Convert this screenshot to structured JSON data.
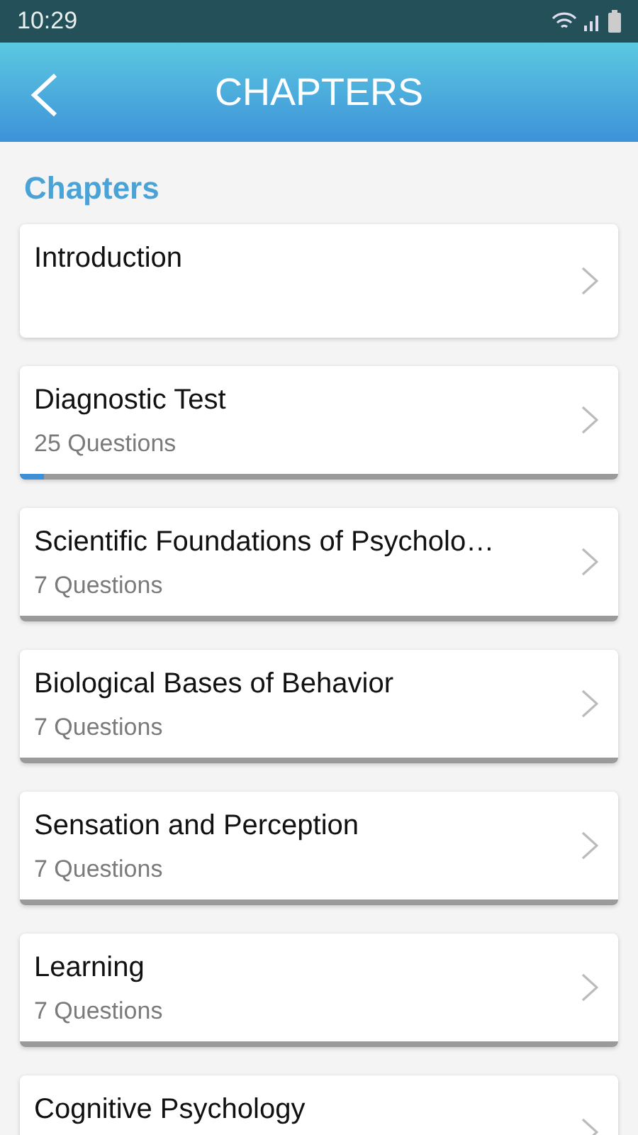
{
  "status_bar": {
    "time": "10:29"
  },
  "header": {
    "title": "CHAPTERS"
  },
  "section_title": "Chapters",
  "chapters": [
    {
      "title": "Introduction"
    },
    {
      "title": "Diagnostic Test",
      "subtitle": "25 Questions",
      "level": 0.04
    },
    {
      "title": "Scientific Foundations of Psycholo…",
      "subtitle": "7 Questions",
      "level": 0
    },
    {
      "title": "Biological Bases of Behavior",
      "subtitle": "7 Questions",
      "level": 0
    },
    {
      "title": "Sensation and Perception",
      "subtitle": "7 Questions",
      "level": 0
    },
    {
      "title": "Learning",
      "subtitle": "7 Questions",
      "level": 0
    },
    {
      "title": "Cognitive Psychology"
    }
  ]
}
